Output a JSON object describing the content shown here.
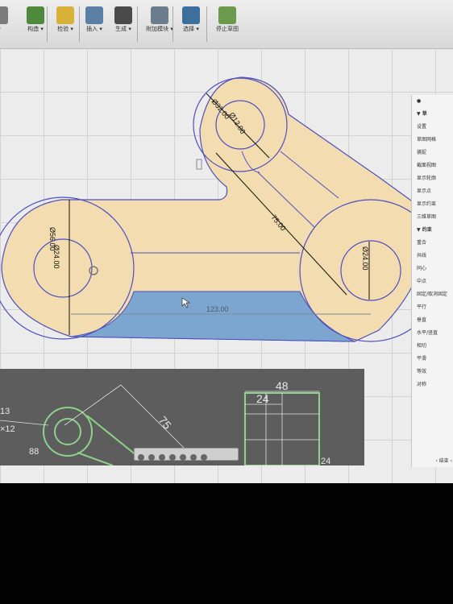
{
  "toolbar": {
    "tools": [
      {
        "label": "▾",
        "icon": "partial-tool-icon",
        "color": "#7a7a7a"
      },
      {
        "label": "构造 ▾",
        "icon": "construct-icon",
        "color": "#4f8a3c"
      },
      {
        "label": "检验 ▾",
        "icon": "inspect-icon",
        "color": "#d8b13a"
      },
      {
        "label": "插入 ▾",
        "icon": "insert-icon",
        "color": "#5c7fa6"
      },
      {
        "label": "生成 ▾",
        "icon": "make-icon",
        "color": "#4a4a4a"
      },
      {
        "label": "附加模块 ▾",
        "icon": "addins-icon",
        "color": "#6b7c8f"
      },
      {
        "label": "选择 ▾",
        "icon": "select-cursor-icon",
        "color": "#3d6f9c"
      },
      {
        "label": "停止草图",
        "icon": "stop-sketch-icon",
        "color": "#6c9a4c"
      }
    ]
  },
  "sketch": {
    "dimensions": {
      "top_diameters": "Ø32.00",
      "top_inner": "Ø12.00",
      "left_outer": "Ø56.00",
      "left_inner": "Ø24.00",
      "right_inner": "Ø24.00",
      "diagonal": "75.00",
      "bottom_width": "123.00"
    },
    "fill_color": "#f2dcb0",
    "selected_color": "#7ca6cf",
    "line_color": "#4f4fc0"
  },
  "panel": {
    "sections": [
      {
        "label": "▼ 草",
        "header": true
      },
      {
        "label": "设置",
        "header": false
      },
      {
        "label": "草图网格",
        "header": false
      },
      {
        "label": "捕捉",
        "header": false
      },
      {
        "label": "截面视图",
        "header": false
      },
      {
        "label": "显示轮廓",
        "header": false
      },
      {
        "label": "显示点",
        "header": false
      },
      {
        "label": "显示约束",
        "header": false
      },
      {
        "label": "三维草图",
        "header": false
      },
      {
        "label": "▼ 约束",
        "header": true
      },
      {
        "label": "重合",
        "header": false
      },
      {
        "label": "共线",
        "header": false
      },
      {
        "label": "同心",
        "header": false
      },
      {
        "label": "中点",
        "header": false
      },
      {
        "label": "固定/取消固定",
        "header": false
      },
      {
        "label": "平行",
        "header": false
      },
      {
        "label": "垂直",
        "header": false
      },
      {
        "label": "水平/竖直",
        "header": false
      },
      {
        "label": "相切",
        "header": false
      },
      {
        "label": "平滑",
        "header": false
      },
      {
        "label": "等效",
        "header": false
      },
      {
        "label": "对称",
        "header": false
      }
    ],
    "footer": "‹ 结束 ‹"
  },
  "drawing_view": {
    "dim_48": "48",
    "dim_24": "24",
    "dim_75": "75",
    "dim_12": "×12",
    "dim_13": "13",
    "dim_24b": "24",
    "dim_88": "88",
    "line_color": "#8fd18a"
  }
}
